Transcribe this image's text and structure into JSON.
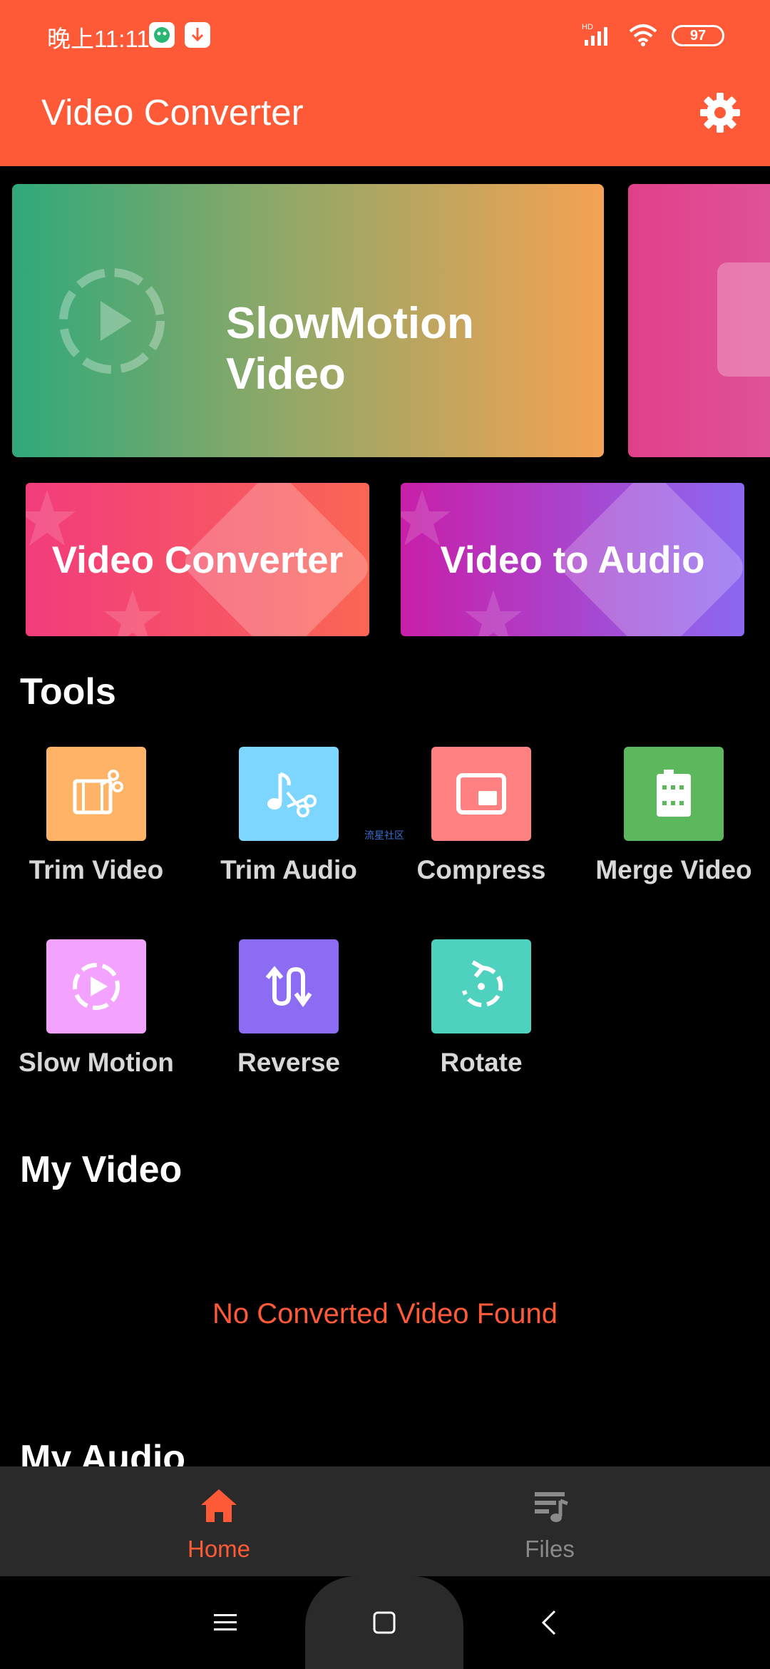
{
  "status_bar": {
    "time": "晚上11:11",
    "battery": "97",
    "network": "HD"
  },
  "app_bar": {
    "title": "Video Converter",
    "settings_icon": "gear-icon"
  },
  "banners": {
    "featured_label": "SlowMotion Video",
    "card_left_label": "Video Converter",
    "card_right_label": "Video to Audio"
  },
  "tools": {
    "title": "Tools",
    "items": [
      {
        "label": "Trim Video",
        "color": "#FFB366",
        "icon": "film-scissors-icon"
      },
      {
        "label": "Trim Audio",
        "color": "#7DD6FF",
        "icon": "music-scissors-icon"
      },
      {
        "label": "Compress",
        "color": "#FF8080",
        "icon": "picture-in-picture-icon"
      },
      {
        "label": "Merge Video",
        "color": "#5CB85C",
        "icon": "film-strip-icon"
      },
      {
        "label": "Slow Motion",
        "color": "#F3A3FF",
        "icon": "slow-play-icon"
      },
      {
        "label": "Reverse",
        "color": "#8C6CF2",
        "icon": "reverse-arrows-icon"
      },
      {
        "label": "Rotate",
        "color": "#4FD1BF",
        "icon": "rotate-icon"
      }
    ]
  },
  "watermark": "流星社区",
  "my_video": {
    "title": "My Video",
    "empty_message": "No Converted Video Found"
  },
  "my_audio": {
    "title": "My Audio"
  },
  "bottom_nav": {
    "home_label": "Home",
    "files_label": "Files"
  },
  "colors": {
    "accent": "#FF5A37",
    "background": "#000000",
    "nav_background": "#2A2A2A"
  }
}
